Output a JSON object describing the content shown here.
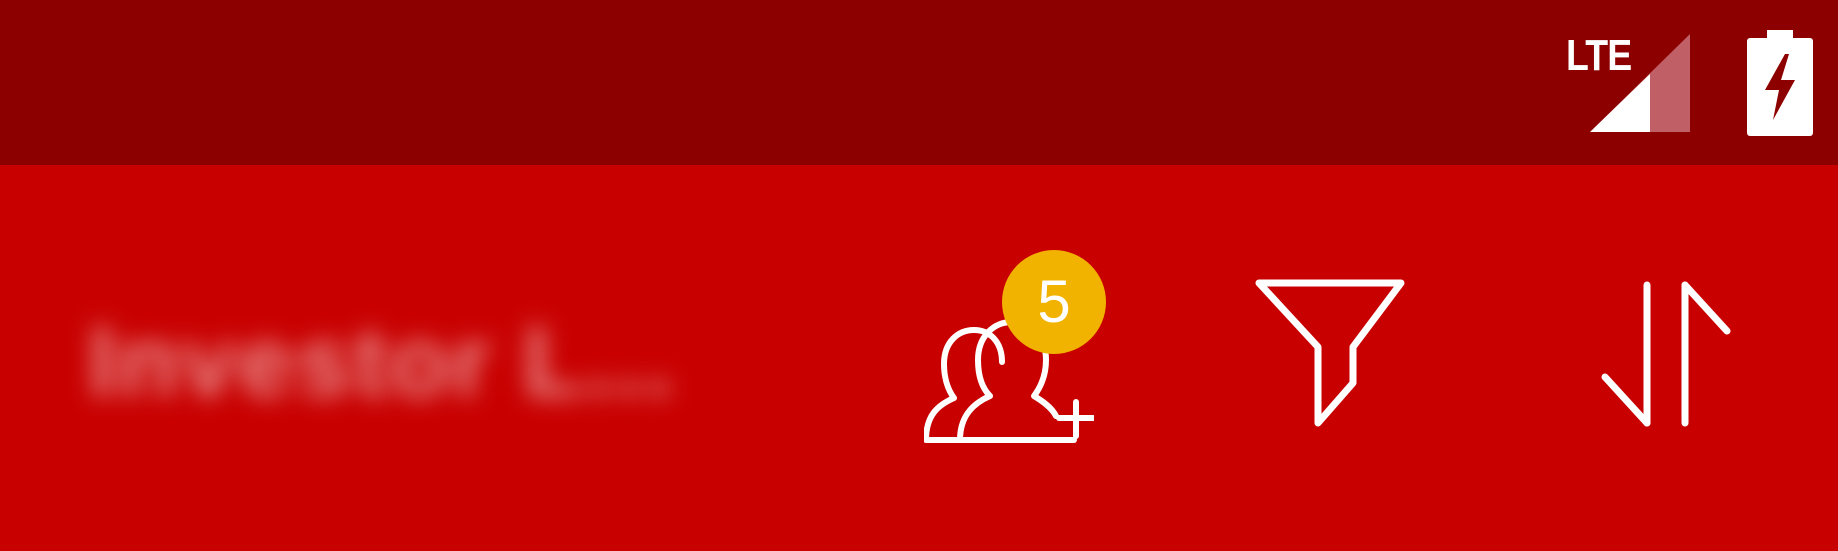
{
  "status_bar": {
    "network": "LTE",
    "icons": [
      "signal-icon",
      "battery-charging-icon"
    ]
  },
  "app_bar": {
    "title": "Investor L...",
    "actions": {
      "add_users": {
        "icon": "add-users-icon",
        "badge_count": "5"
      },
      "filter": {
        "icon": "filter-icon"
      },
      "sort": {
        "icon": "sort-icon"
      }
    }
  },
  "colors": {
    "status_bar": "#8d0000",
    "app_bar": "#c90000",
    "badge": "#f2b200",
    "icon": "#ffffff"
  }
}
